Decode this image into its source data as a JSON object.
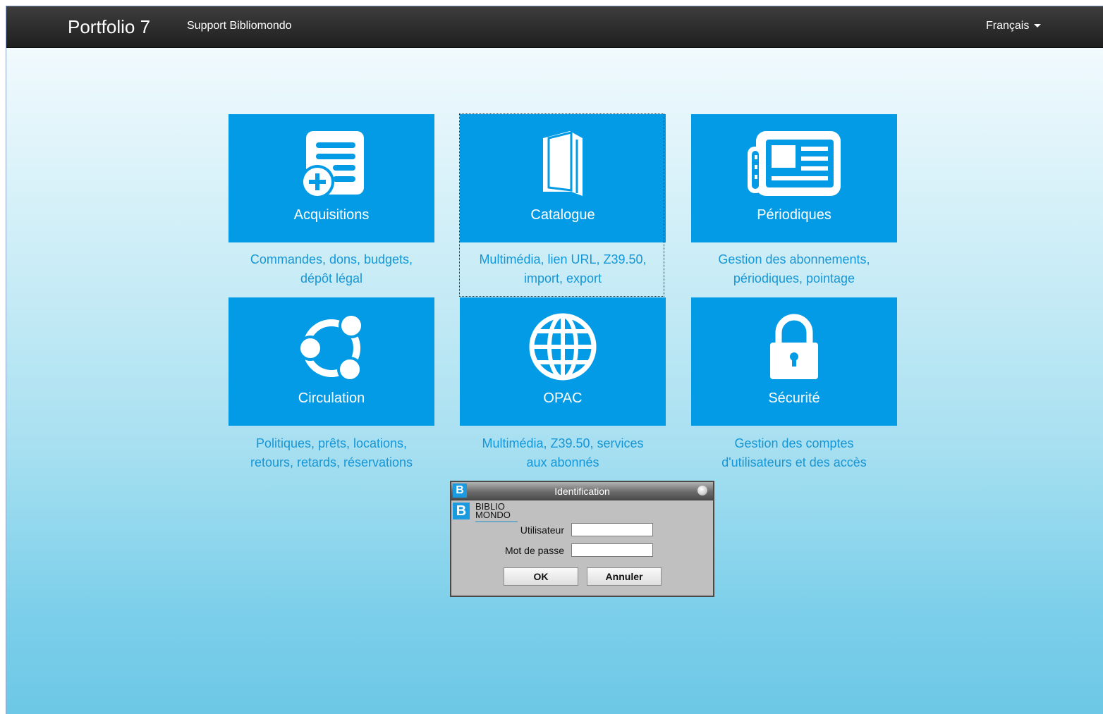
{
  "navbar": {
    "brand": "Portfolio 7",
    "support_link": "Support Bibliomondo",
    "language": "Français"
  },
  "tiles": [
    {
      "label": "Acquisitions",
      "icon": "acquisitions-icon",
      "description_line1": "Commandes, dons, budgets,",
      "description_line2": "dépôt légal"
    },
    {
      "label": "Catalogue",
      "icon": "book-icon",
      "description_line1": "Multimédia, lien URL, Z39.50,",
      "description_line2": "import, export"
    },
    {
      "label": "Périodiques",
      "icon": "newspaper-icon",
      "description_line1": "Gestion des abonnements,",
      "description_line2": "périodiques, pointage"
    },
    {
      "label": "Circulation",
      "icon": "circulation-icon",
      "description_line1": "Politiques, prêts, locations,",
      "description_line2": "retours, retards, réservations"
    },
    {
      "label": "OPAC",
      "icon": "globe-icon",
      "description_line1": "Multimédia, Z39.50, services",
      "description_line2": "aux abonnés"
    },
    {
      "label": "Sécurité",
      "icon": "lock-icon",
      "description_line1": "Gestion des comptes",
      "description_line2": "d'utilisateurs et des accès"
    }
  ],
  "dialog": {
    "title": "Identification",
    "logo_line1": "BIBLIO",
    "logo_line2": "MONDO",
    "user_label": "Utilisateur",
    "user_value": "",
    "password_label": "Mot de passe",
    "password_value": "",
    "ok_label": "OK",
    "cancel_label": "Annuler"
  },
  "colors": {
    "tile": "#039be5",
    "description_text": "#1596d6",
    "navbar": "#2b2b2b"
  }
}
